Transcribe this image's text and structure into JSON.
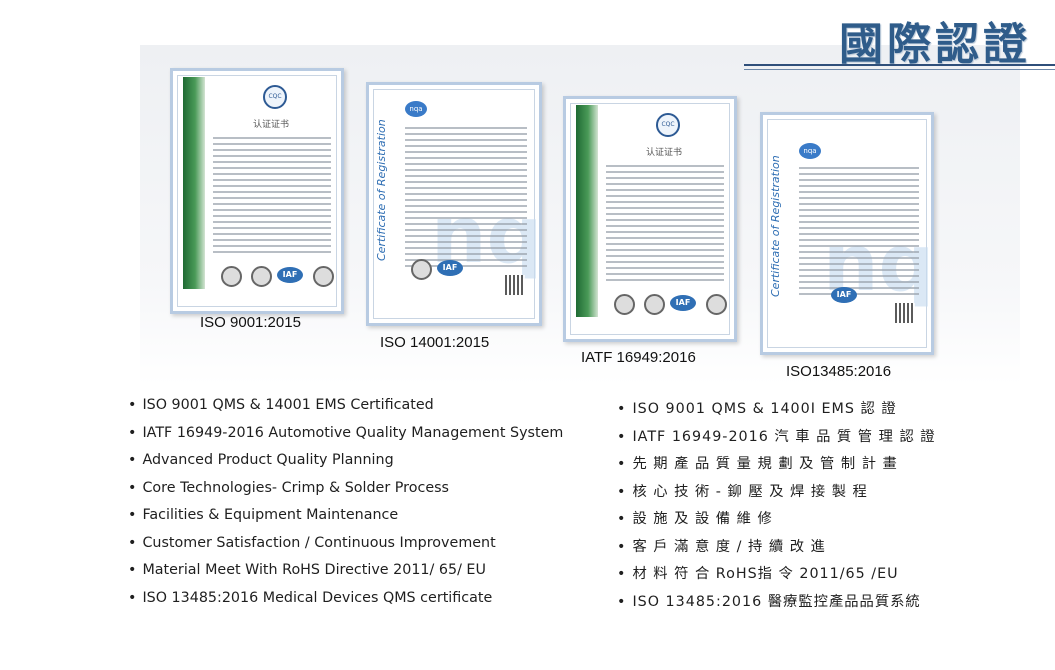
{
  "title": "國際認證",
  "certificates": [
    {
      "caption": "ISO 9001:2015",
      "heading": "认证证书",
      "badge": "IAF"
    },
    {
      "caption": "ISO 14001:2015",
      "heading": "Certificate of Registration",
      "badge": "IAF",
      "watermark": "nqa"
    },
    {
      "caption": "IATF 16949:2016",
      "heading": "认证证书",
      "badge": "IAF"
    },
    {
      "caption": "ISO13485:2016",
      "heading": "Certificate of Registration",
      "badge": "IAF",
      "watermark": "nqa"
    }
  ],
  "list_en": [
    "ISO 9001 QMS & 14001 EMS Certificated",
    "IATF 16949-2016 Automotive Quality Management System",
    "Advanced Product Quality Planning",
    "Core Technologies- Crimp & Solder Process",
    "Facilities & Equipment Maintenance",
    "Customer Satisfaction / Continuous Improvement",
    "Material Meet With RoHS Directive 2011/ 65/ EU",
    "ISO 13485:2016 Medical Devices QMS certificate"
  ],
  "list_zh": [
    "ISO 9001 QMS & 1400I EMS 認 證",
    "IATF 16949-2016  汽 車 品 質 管 理 認 證",
    "先 期 產 品 質 量 規 劃 及 管 制 計 畫",
    "核 心 技 術 - 鉚 壓 及 焊 接 製 程",
    "設 施 及 設 備 維 修",
    "客 戶 滿 意 度 / 持 續 改 進",
    "材 料 符 合 RoHS指 令 2011/65 /EU",
    "ISO 13485:2016 醫療監控產品品質系統"
  ]
}
